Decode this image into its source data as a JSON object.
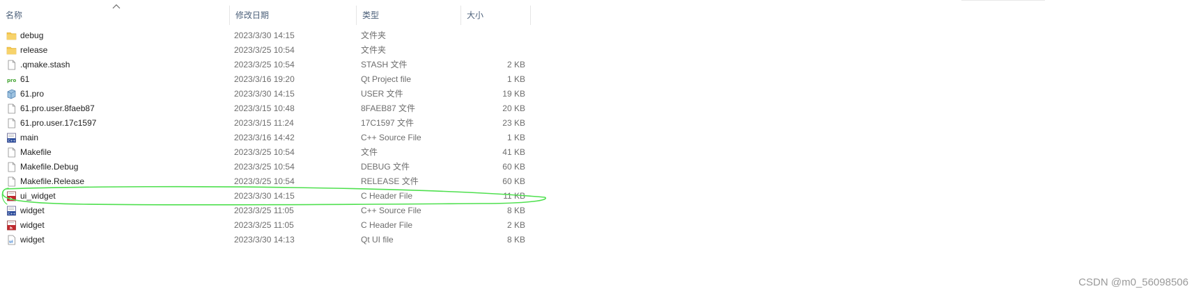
{
  "columns": {
    "name": "名称",
    "date": "修改日期",
    "type": "类型",
    "size": "大小"
  },
  "files": [
    {
      "name": "debug",
      "date": "2023/3/30 14:15",
      "type": "文件夹",
      "size": "",
      "icon": "folder-icon"
    },
    {
      "name": "release",
      "date": "2023/3/25 10:54",
      "type": "文件夹",
      "size": "",
      "icon": "folder-icon"
    },
    {
      "name": ".qmake.stash",
      "date": "2023/3/25 10:54",
      "type": "STASH 文件",
      "size": "2 KB",
      "icon": "file-icon"
    },
    {
      "name": "61",
      "date": "2023/3/16 19:20",
      "type": "Qt Project file",
      "size": "1 KB",
      "icon": "qt-pro-icon"
    },
    {
      "name": "61.pro",
      "date": "2023/3/30 14:15",
      "type": "USER 文件",
      "size": "19 KB",
      "icon": "user-file-icon"
    },
    {
      "name": "61.pro.user.8faeb87",
      "date": "2023/3/15 10:48",
      "type": "8FAEB87 文件",
      "size": "20 KB",
      "icon": "file-icon"
    },
    {
      "name": "61.pro.user.17c1597",
      "date": "2023/3/15 11:24",
      "type": "17C1597 文件",
      "size": "23 KB",
      "icon": "file-icon"
    },
    {
      "name": "main",
      "date": "2023/3/16 14:42",
      "type": "C++ Source File",
      "size": "1 KB",
      "icon": "cpp-file-icon"
    },
    {
      "name": "Makefile",
      "date": "2023/3/25 10:54",
      "type": "文件",
      "size": "41 KB",
      "icon": "file-icon"
    },
    {
      "name": "Makefile.Debug",
      "date": "2023/3/25 10:54",
      "type": "DEBUG 文件",
      "size": "60 KB",
      "icon": "file-icon"
    },
    {
      "name": "Makefile.Release",
      "date": "2023/3/25 10:54",
      "type": "RELEASE 文件",
      "size": "60 KB",
      "icon": "file-icon"
    },
    {
      "name": "ui_widget",
      "date": "2023/3/30 14:15",
      "type": "C Header File",
      "size": "11 KB",
      "icon": "h-file-icon"
    },
    {
      "name": "widget",
      "date": "2023/3/25 11:05",
      "type": "C++ Source File",
      "size": "8 KB",
      "icon": "cpp-file-icon"
    },
    {
      "name": "widget",
      "date": "2023/3/25 11:05",
      "type": "C Header File",
      "size": "2 KB",
      "icon": "h-file-icon"
    },
    {
      "name": "widget",
      "date": "2023/3/30 14:13",
      "type": "Qt UI file",
      "size": "8 KB",
      "icon": "ui-file-icon"
    }
  ],
  "watermark": "CSDN @m0_56098506",
  "colors": {
    "folder": "#f4c74c",
    "highlight_mark": "#4ee04e",
    "header_text": "#4c607a"
  }
}
